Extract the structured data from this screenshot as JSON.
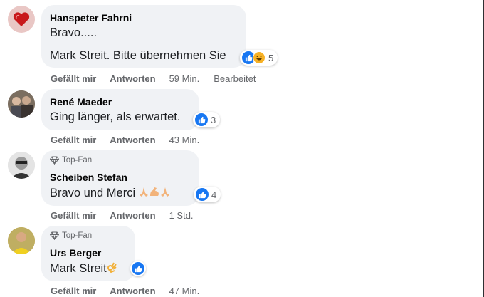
{
  "comments": [
    {
      "author": "Hanspeter Fahrni",
      "badge": "",
      "lines": [
        "Bravo.....",
        "Mark Streit. Bitte übernehmen Sie"
      ],
      "reaction_count": "5",
      "actions": {
        "like": "Gefällt mir",
        "reply": "Antworten",
        "time": "59 Min.",
        "edited": "Bearbeitet"
      }
    },
    {
      "author": "René Maeder",
      "badge": "",
      "lines": [
        "Ging länger, als erwartet."
      ],
      "reaction_count": "3",
      "actions": {
        "like": "Gefällt mir",
        "reply": "Antworten",
        "time": "43 Min."
      }
    },
    {
      "author": "Scheiben Stefan",
      "badge": "Top-Fan",
      "lines": [
        "Bravo und Merci"
      ],
      "reaction_count": "4",
      "actions": {
        "like": "Gefällt mir",
        "reply": "Antworten",
        "time": "1 Std."
      }
    },
    {
      "author": "Urs Berger",
      "badge": "Top-Fan",
      "lines": [
        "Mark Streit"
      ],
      "reaction_count": "",
      "actions": {
        "like": "Gefällt mir",
        "reply": "Antworten",
        "time": "47 Min."
      }
    }
  ],
  "colors": {
    "bubble": "#f0f2f5",
    "like_blue": "#1877f2",
    "meta_gray": "#65676b"
  },
  "icons": [
    "heart-avatar",
    "like-icon",
    "haha-icon",
    "diamond-icon",
    "praying-hands-emoji",
    "flexed-biceps-emoji",
    "ok-hand-emoji"
  ]
}
